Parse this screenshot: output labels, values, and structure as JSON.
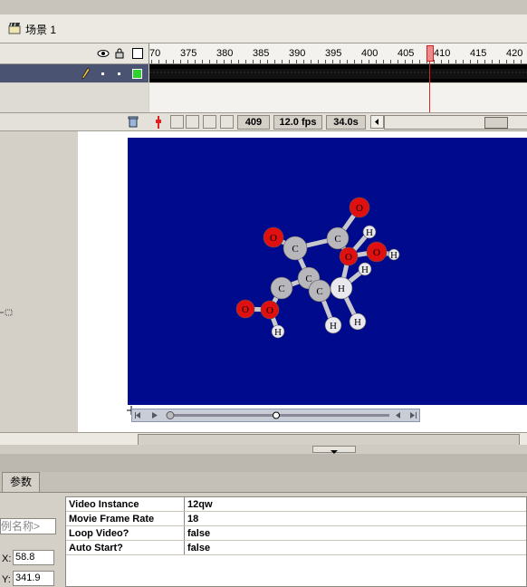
{
  "scene": {
    "label": "场景 1"
  },
  "timeline": {
    "ruler_labels": [
      "70",
      "375",
      "380",
      "385",
      "390",
      "395",
      "400",
      "405",
      "410",
      "415",
      "420"
    ],
    "current_frame": "409",
    "fps": "12.0 fps",
    "elapsed": "34.0s"
  },
  "atoms": [
    {
      "label": "O"
    },
    {
      "label": "C"
    },
    {
      "label": "H"
    },
    {
      "label": "O"
    },
    {
      "label": "C"
    },
    {
      "label": "O"
    },
    {
      "label": "H"
    },
    {
      "label": "O"
    },
    {
      "label": "H"
    },
    {
      "label": "C"
    },
    {
      "label": "C"
    },
    {
      "label": "C"
    },
    {
      "label": "H"
    },
    {
      "label": "O"
    },
    {
      "label": "O"
    },
    {
      "label": "H"
    },
    {
      "label": "H"
    },
    {
      "label": "H"
    }
  ],
  "properties": {
    "tab_label": "参数",
    "instance_name_placeholder": "例名称>",
    "x_label": "X:",
    "x_value": "58.8",
    "y_label": "Y:",
    "y_value": "341.9",
    "params": [
      {
        "name": "Video Instance",
        "value": "12qw"
      },
      {
        "name": "Movie Frame Rate",
        "value": "18"
      },
      {
        "name": "Loop Video?",
        "value": "false"
      },
      {
        "name": "Auto Start?",
        "value": "false"
      }
    ]
  }
}
